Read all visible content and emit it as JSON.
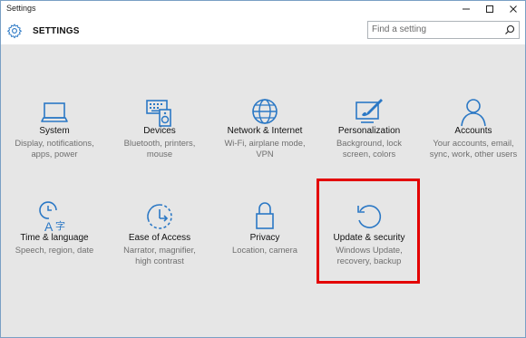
{
  "window": {
    "title": "Settings"
  },
  "header": {
    "label": "SETTINGS"
  },
  "search": {
    "placeholder": "Find a setting"
  },
  "tiles": [
    {
      "title": "System",
      "desc": [
        "Display, notifications,",
        "apps, power"
      ],
      "icon": "laptop-icon"
    },
    {
      "title": "Devices",
      "desc": [
        "Bluetooth, printers,",
        "mouse"
      ],
      "icon": "devices-icon"
    },
    {
      "title": "Network & Internet",
      "desc": [
        "Wi-Fi, airplane mode,",
        "VPN"
      ],
      "icon": "globe-icon"
    },
    {
      "title": "Personalization",
      "desc": [
        "Background, lock",
        "screen, colors"
      ],
      "icon": "paint-icon"
    },
    {
      "title": "Accounts",
      "desc": [
        "Your accounts, email,",
        "sync, work, other users"
      ],
      "icon": "person-icon"
    },
    {
      "title": "Time & language",
      "desc": [
        "Speech, region, date"
      ],
      "icon": "time-language-icon"
    },
    {
      "title": "Ease of Access",
      "desc": [
        "Narrator, magnifier,",
        "high contrast"
      ],
      "icon": "ease-of-access-icon"
    },
    {
      "title": "Privacy",
      "desc": [
        "Location, camera"
      ],
      "icon": "lock-icon"
    },
    {
      "title": "Update & security",
      "desc": [
        "Windows Update,",
        "recovery, backup"
      ],
      "icon": "update-icon"
    }
  ],
  "colors": {
    "accent": "#2b78c5",
    "highlight": "#e30000"
  }
}
